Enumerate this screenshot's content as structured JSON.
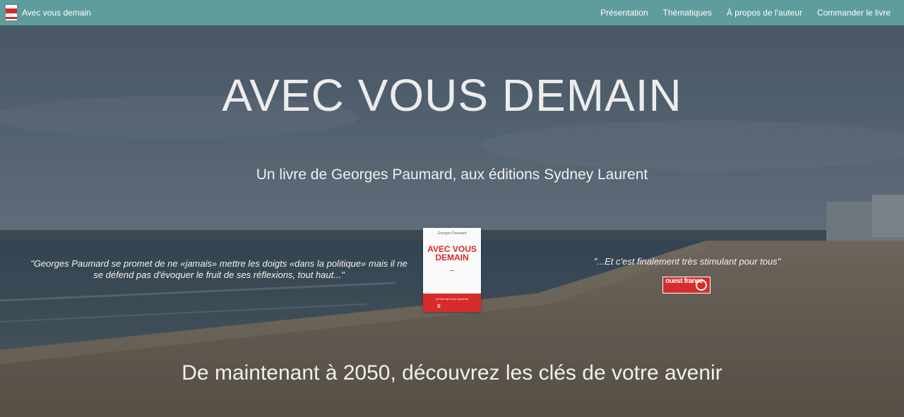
{
  "navbar": {
    "brand": "Avec vous demain",
    "links": [
      "Présentation",
      "Thématiques",
      "À propos de l'auteur",
      "Commander le livre"
    ]
  },
  "hero": {
    "title": "AVEC VOUS DEMAIN",
    "subtitle": "Un livre de Georges Paumard, aux éditions Sydney Laurent",
    "quote_left": "\"Georges Paumard se promet de ne «jamais» mettre les doigts «dans la politique» mais il ne se défend pas d'évoquer le fruit de ses réflexions, tout haut...\"",
    "quote_right": "\"...Et c'est finalement très stimulant pour tous\"",
    "press_logo": "ouest france",
    "tagline": "De maintenant à 2050, découvrez les clés de votre avenir"
  },
  "book": {
    "author": "Georges Paumard",
    "title": "AVEC VOUS DEMAIN",
    "tag": "Le livre qui vous concerne",
    "publisher_mark": "S"
  },
  "colors": {
    "navbar": "#5f9c9c",
    "accent_red": "#d62c2c"
  }
}
